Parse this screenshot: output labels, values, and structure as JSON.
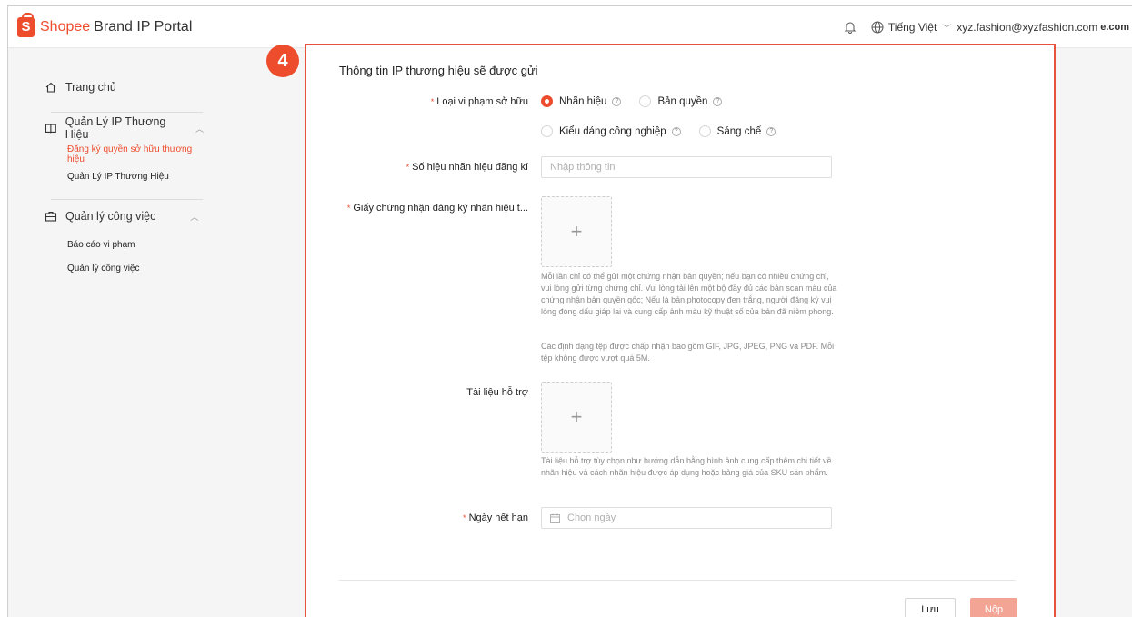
{
  "header": {
    "brand_part1": "Shopee",
    "brand_part2": "Brand IP Portal",
    "logo_letter": "S",
    "language": "Tiếng Việt",
    "user_email": "xyz.fashion@xyzfashion.com",
    "email_suffix": "e.com"
  },
  "sidebar": {
    "home": "Trang chủ",
    "brand_ip_group": "Quản Lý IP Thương Hiệu",
    "brand_ip_items": [
      "Đăng ký quyền sở hữu thương hiệu",
      "Quản Lý IP Thương Hiệu"
    ],
    "work_group": "Quản lý công việc",
    "work_items": [
      "Báo cáo vi phạm",
      "Quản lý công việc"
    ]
  },
  "step_badge": "4",
  "form": {
    "title": "Thông tin IP thương hiệu sẽ được gửi",
    "violation_type_label": "Loại vi phạm sở hữu",
    "violation_options": [
      "Nhãn hiệu",
      "Bản quyền",
      "Kiểu dáng công nghiệp",
      "Sáng chế"
    ],
    "selected_violation": "Nhãn hiệu",
    "trademark_number_label": "Số hiệu nhãn hiệu đăng kí",
    "trademark_number_placeholder": "Nhập thông tin",
    "certificate_label": "Giấy chứng nhận đăng ký nhãn hiệu t...",
    "certificate_hint_1": "Mỗi lần chỉ có thể gửi một chứng nhận bản quyền; nếu bạn có nhiều chứng chỉ, vui lòng gửi từng chứng chỉ. Vui lòng tải lên một bộ đầy đủ các bản scan màu của chứng nhận bản quyền gốc; Nếu là bản photocopy đen trắng, người đăng ký vui lòng đóng dấu giáp lai và cung cấp ảnh màu kỹ thuật số của bản đã niêm phong.",
    "certificate_hint_2": "Các định dạng tệp được chấp nhận bao gồm GIF, JPG, JPEG, PNG và PDF. Mỗi tệp không được vượt quá 5M.",
    "support_docs_label": "Tài liệu hỗ trợ",
    "support_docs_hint": "Tài liệu hỗ trợ tùy chọn như hướng dẫn bằng hình ảnh cung cấp thêm chi tiết về nhãn hiệu và cách nhãn hiệu được áp dụng hoặc bảng giá của SKU sản phẩm.",
    "expiry_label": "Ngày hết hạn",
    "expiry_placeholder": "Chọn ngày",
    "plus_symbol": "+",
    "help_symbol": "?",
    "required_mark": "*"
  },
  "actions": {
    "save": "Lưu",
    "submit": "Nộp"
  },
  "colors": {
    "brand": "#ee4d2d",
    "submit_disabled": "#f3a494"
  }
}
